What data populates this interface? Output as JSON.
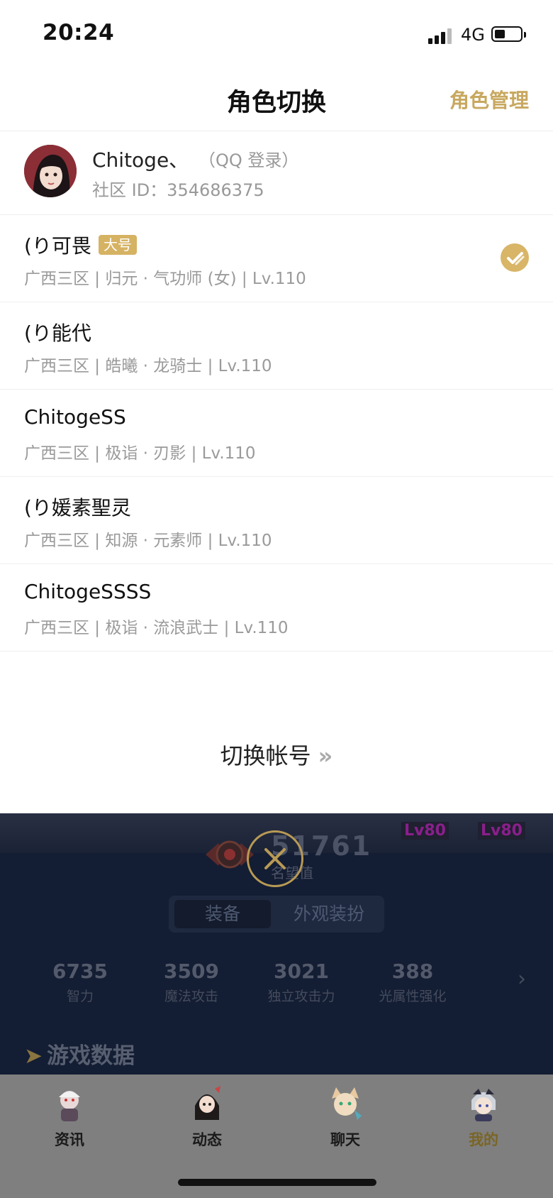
{
  "status_bar": {
    "time": "20:24",
    "network": "4G"
  },
  "header": {
    "title": "角色切换",
    "manage_label": "角色管理"
  },
  "account": {
    "name": "Chitoge、",
    "login_type": "（QQ 登录）",
    "community_id": "社区 ID：354686375"
  },
  "roles": [
    {
      "name": "(り可畏",
      "badge": "大号",
      "meta": "广西三区 | 归元 · 气功师 (女) | Lv.110",
      "selected": true
    },
    {
      "name": "(り能代",
      "badge": "",
      "meta": "广西三区 | 皓曦 · 龙骑士 | Lv.110",
      "selected": false
    },
    {
      "name": "ChitogeSS",
      "badge": "",
      "meta": "广西三区 | 极诣 · 刃影 | Lv.110",
      "selected": false
    },
    {
      "name": "(り媛素聖灵",
      "badge": "",
      "meta": "广西三区 | 知源 · 元素师 | Lv.110",
      "selected": false
    },
    {
      "name": "ChitogeSSSS",
      "badge": "",
      "meta": "广西三区 | 极诣 · 流浪武士 | Lv.110",
      "selected": false
    }
  ],
  "switch_account": {
    "label": "切换帐号",
    "chevron": "»"
  },
  "background_page": {
    "level_tags": [
      "Lv80",
      "Lv80"
    ],
    "score": "51761",
    "score_label": "名望值",
    "tabs": [
      "装备",
      "外观装扮"
    ],
    "active_tab": 0,
    "stats": [
      {
        "value": "6735",
        "label": "智力"
      },
      {
        "value": "3509",
        "label": "魔法攻击"
      },
      {
        "value": "3021",
        "label": "独立攻击力"
      },
      {
        "value": "388",
        "label": "光属性强化"
      }
    ],
    "section_title": "游戏数据"
  },
  "tabbar": {
    "items": [
      {
        "label": "资讯",
        "icon": "news-character-icon"
      },
      {
        "label": "动态",
        "icon": "feed-character-icon"
      },
      {
        "label": "聊天",
        "icon": "chat-character-icon"
      },
      {
        "label": "我的",
        "icon": "profile-character-icon"
      }
    ],
    "active_index": 3
  },
  "colors": {
    "accent_gold": "#c8a860",
    "check_gold": "#d8b567",
    "badge_gold": "#d6b263",
    "secondary_text": "#9a9a9a",
    "overlay_dark": "#131d33"
  }
}
